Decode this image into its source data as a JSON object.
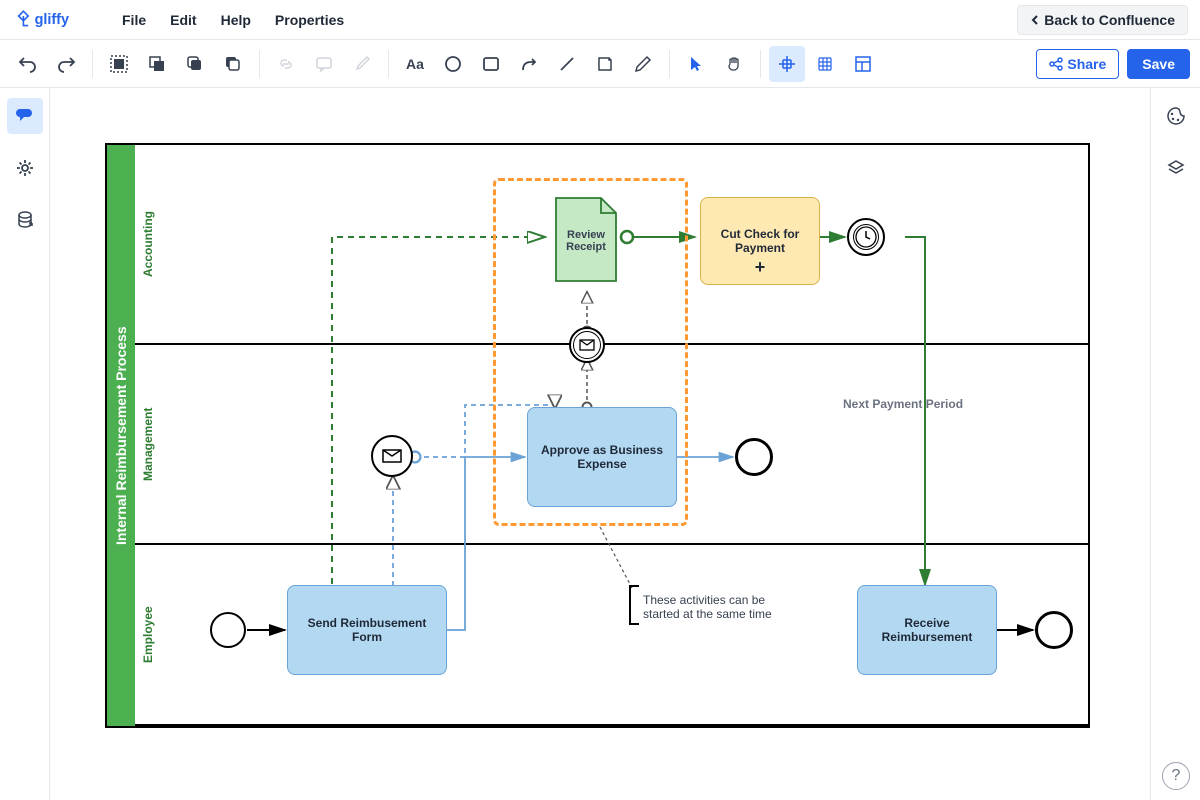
{
  "brand": "gliffy",
  "menu": {
    "file": "File",
    "edit": "Edit",
    "help": "Help",
    "properties": "Properties"
  },
  "back_label": "Back to Confluence",
  "share_label": "Share",
  "save_label": "Save",
  "pool_title": "Internal Reimbursement Process",
  "lanes": {
    "accounting": "Accounting",
    "management": "Management",
    "employee": "Employee"
  },
  "tasks": {
    "review_receipt": "Review Receipt",
    "cut_check": "Cut Check for Payment",
    "approve": "Approve as Business Expense",
    "send_form": "Send Reimbusement Form",
    "receive": "Receive Reimbursement"
  },
  "annotation": "These activities can be started at the same time",
  "edge_label": "Next Payment Period",
  "chart_data": {
    "type": "bpmn",
    "pool": "Internal Reimbursement Process",
    "lanes": [
      "Accounting",
      "Management",
      "Employee"
    ],
    "nodes": [
      {
        "id": "start_emp",
        "type": "start-event",
        "lane": "Employee"
      },
      {
        "id": "send_form",
        "type": "task",
        "lane": "Employee",
        "label": "Send Reimbusement Form"
      },
      {
        "id": "msg_mgmt",
        "type": "intermediate-message-event",
        "lane": "Management"
      },
      {
        "id": "approve",
        "type": "task",
        "lane": "Management",
        "label": "Approve as Business Expense"
      },
      {
        "id": "end_mgmt",
        "type": "end-event",
        "lane": "Management"
      },
      {
        "id": "msg_between",
        "type": "intermediate-message-event",
        "lane": "Management/Accounting boundary"
      },
      {
        "id": "review_receipt",
        "type": "document-task",
        "lane": "Accounting",
        "label": "Review Receipt"
      },
      {
        "id": "cut_check",
        "type": "subprocess",
        "lane": "Accounting",
        "label": "Cut Check for Payment"
      },
      {
        "id": "timer",
        "type": "intermediate-timer-event",
        "lane": "Accounting"
      },
      {
        "id": "receive",
        "type": "task",
        "lane": "Employee",
        "label": "Receive Reimbursement"
      },
      {
        "id": "end_emp",
        "type": "end-event",
        "lane": "Employee"
      }
    ],
    "edges": [
      {
        "from": "start_emp",
        "to": "send_form",
        "type": "sequence"
      },
      {
        "from": "send_form",
        "to": "approve",
        "type": "sequence"
      },
      {
        "from": "send_form",
        "to": "msg_mgmt",
        "type": "message"
      },
      {
        "from": "send_form",
        "to": "review_receipt",
        "type": "message",
        "style": "dashed-green"
      },
      {
        "from": "msg_mgmt",
        "to": "approve",
        "type": "message"
      },
      {
        "from": "approve",
        "to": "end_mgmt",
        "type": "sequence"
      },
      {
        "from": "approve",
        "to": "msg_between",
        "type": "message"
      },
      {
        "from": "msg_between",
        "to": "review_receipt",
        "type": "message"
      },
      {
        "from": "review_receipt",
        "to": "cut_check",
        "type": "sequence",
        "style": "green"
      },
      {
        "from": "cut_check",
        "to": "timer",
        "type": "sequence",
        "style": "green"
      },
      {
        "from": "timer",
        "to": "receive",
        "type": "sequence",
        "style": "green",
        "label": "Next Payment Period"
      },
      {
        "from": "receive",
        "to": "end_emp",
        "type": "sequence"
      }
    ],
    "group": {
      "contains": [
        "review_receipt",
        "approve"
      ],
      "annotation": "These activities can be started at the same time"
    }
  }
}
